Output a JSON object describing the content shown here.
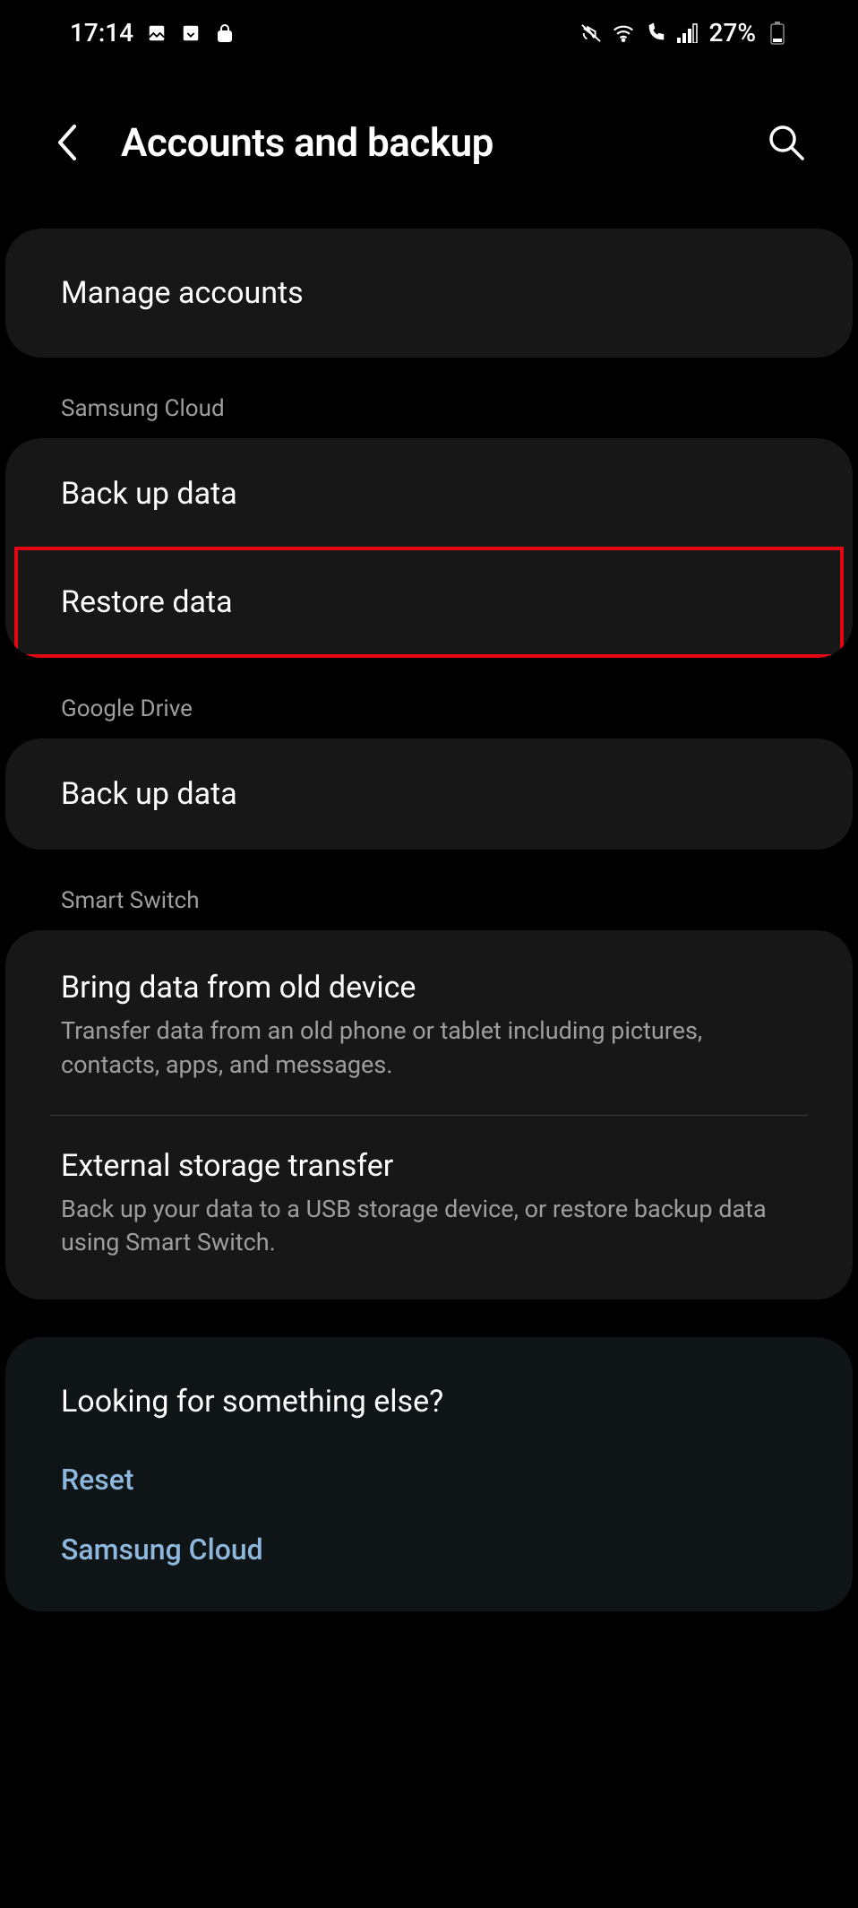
{
  "status": {
    "time": "17:14",
    "battery_pct": "27%"
  },
  "header": {
    "title": "Accounts and backup"
  },
  "groups": {
    "manage": {
      "title": "Manage accounts"
    },
    "samsung_cloud": {
      "header": "Samsung Cloud",
      "backup": "Back up data",
      "restore": "Restore data"
    },
    "google_drive": {
      "header": "Google Drive",
      "backup": "Back up data"
    },
    "smart_switch": {
      "header": "Smart Switch",
      "bring_title": "Bring data from old device",
      "bring_sub": "Transfer data from an old phone or tablet including pictures, contacts, apps, and messages.",
      "ext_title": "External storage transfer",
      "ext_sub": "Back up your data to a USB storage device, or restore backup data using Smart Switch."
    }
  },
  "footer": {
    "title": "Looking for something else?",
    "reset": "Reset",
    "samsung_cloud": "Samsung Cloud"
  }
}
